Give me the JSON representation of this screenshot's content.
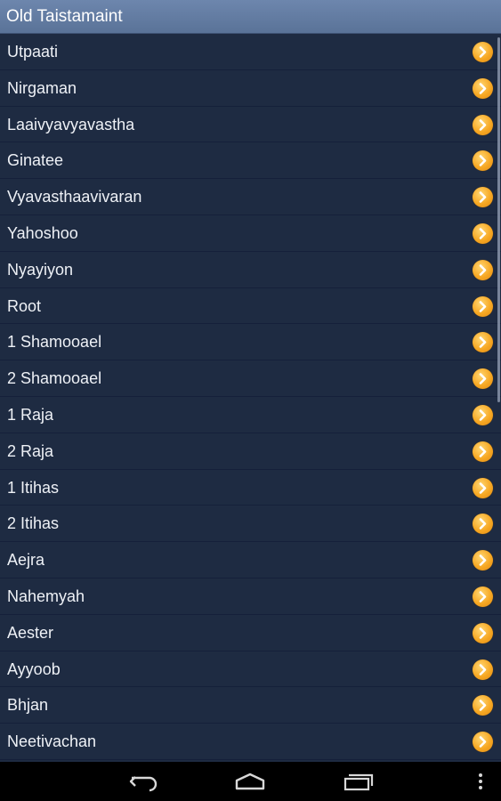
{
  "header": {
    "title": "Old Taistamaint"
  },
  "books": [
    "Utpaati",
    "Nirgaman",
    "Laaivyavyavastha",
    "Ginatee",
    "Vyavasthaavivaran",
    "Yahoshoo",
    "Nyayiyon",
    "Root",
    "1 Shamooael",
    "2 Shamooael",
    "1 Raja",
    "2 Raja",
    "1 Itihas",
    "2 Itihas",
    "Aejra",
    "Nahemyah",
    "Aester",
    "Ayyoob",
    "Bhjan",
    "Neetivachan"
  ],
  "icons": {
    "row_action": "chevron-right-circle-icon",
    "back": "back-icon",
    "home": "home-icon",
    "recents": "recent-apps-icon",
    "menu": "overflow-menu-icon"
  },
  "colors": {
    "header_bg": "#5f789e",
    "list_bg": "#1e2b42",
    "row_text": "#eef1f6",
    "accent": "#f7a823",
    "nav_bg": "#000000"
  }
}
